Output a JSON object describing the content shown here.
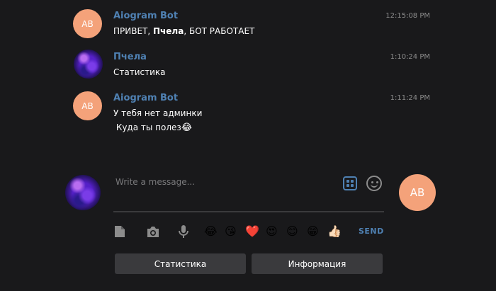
{
  "messages": [
    {
      "author": "Aiogram Bot",
      "avatar_initials": "AB",
      "time": "12:15:08 PM",
      "text_prefix": "ПРИВЕТ, ",
      "text_bold": "Пчела",
      "text_suffix": ", БОТ РАБОТАЕТ"
    },
    {
      "author": "Пчела",
      "time": "1:10:24 PM",
      "text": "Статистика"
    },
    {
      "author": "Aiogram Bot",
      "avatar_initials": "AB",
      "time": "1:11:24 PM",
      "text_line1": "У тебя нет админки",
      "text_line2": " Куда ты полез",
      "text_emoji": "😂"
    }
  ],
  "composer": {
    "placeholder": "Write a message...",
    "self_initials": "AB"
  },
  "toolbar": {
    "emojis": [
      "😂",
      "😘",
      "❤️",
      "😍",
      "😊",
      "😁",
      "👍🏻"
    ],
    "send_label": "SEND"
  },
  "keyboard": [
    "Статистика",
    "Информация"
  ],
  "colors": {
    "background": "#19191b",
    "accent": "#4f81b3",
    "initials_avatar": "#f4a27a",
    "button": "#3a3a3d"
  }
}
